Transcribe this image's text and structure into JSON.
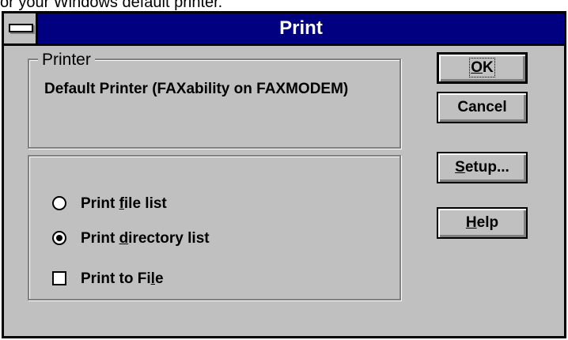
{
  "background_text": "or your Windows default printer.",
  "dialog": {
    "title": "Print",
    "system_menu": "system-menu-icon"
  },
  "printer_group": {
    "label": "Printer",
    "printer_name": "Default Printer (FAXability on FAXMODEM)"
  },
  "options": {
    "print_file_list": {
      "pre": "Print ",
      "acc": "f",
      "post": "ile list",
      "selected": false
    },
    "print_directory_list": {
      "pre": "Print ",
      "acc": "d",
      "post": "irectory list",
      "selected": true
    },
    "print_to_file": {
      "pre": "Print to Fi",
      "acc": "l",
      "post": "e",
      "checked": false
    }
  },
  "buttons": {
    "ok": {
      "acc": "O",
      "post": "K"
    },
    "cancel": {
      "label": "Cancel"
    },
    "setup": {
      "acc": "S",
      "post": "etup..."
    },
    "help": {
      "acc": "H",
      "post": "elp"
    }
  },
  "colors": {
    "titlebar": "#000080",
    "dialog_face": "#c0c0c0",
    "shadow": "#808080",
    "highlight": "#ffffff"
  }
}
